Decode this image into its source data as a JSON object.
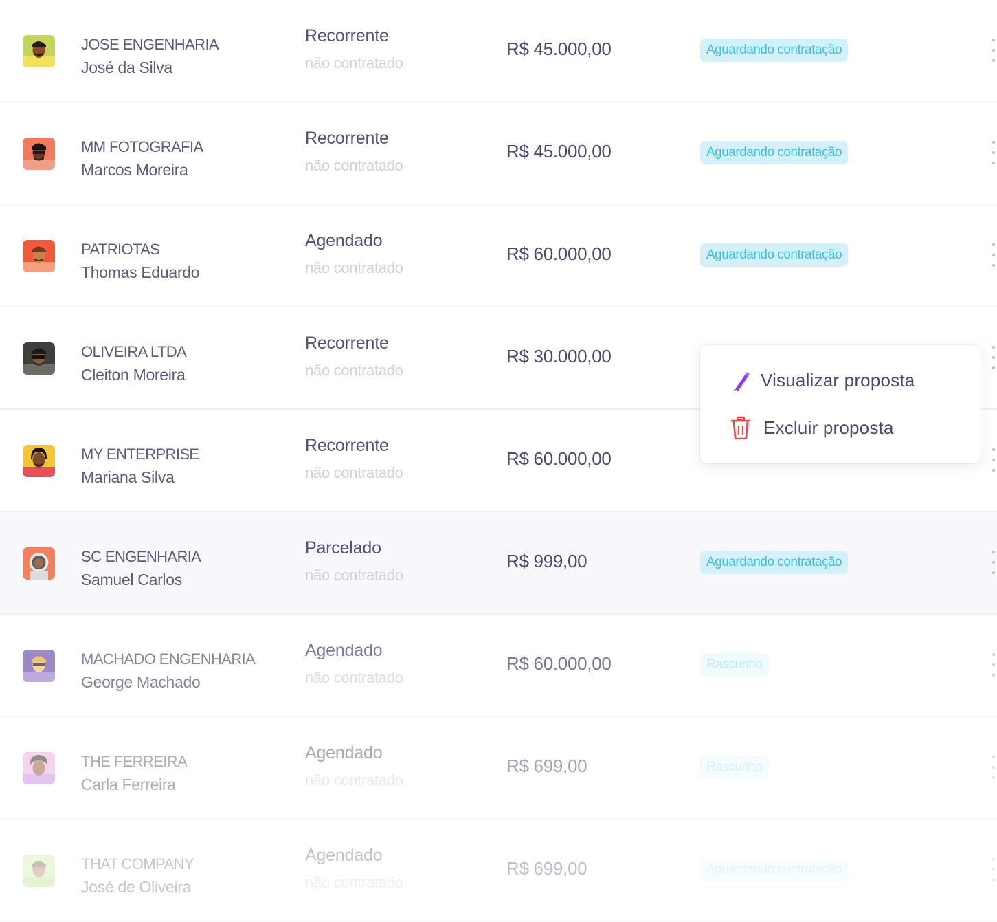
{
  "colors": {
    "text_primary": "#5e5a7d",
    "badge_background": "#d4f1fb",
    "badge_text": "#3cc0e0",
    "edit_icon": "#8b3cf5",
    "delete_icon": "#ee4343"
  },
  "rows": [
    {
      "company": "JOSE ENGENHARIA",
      "person": "José da Silva",
      "type": "Recorrente",
      "contract_status": "não contratado",
      "value": "R$ 45.000,00",
      "status": "Aguardando contratação",
      "avatar_icon": "avatar-man-icon"
    },
    {
      "company": "MM FOTOGRAFIA",
      "person": "Marcos Moreira",
      "type": "Recorrente",
      "contract_status": "não contratado",
      "value": "R$ 45.000,00",
      "status": "Aguardando contratação",
      "avatar_icon": "avatar-man-icon"
    },
    {
      "company": "PATRIOTAS",
      "person": "Thomas Eduardo",
      "type": "Agendado",
      "contract_status": "não contratado",
      "value": "R$ 60.000,00",
      "status": "Aguardando contratação",
      "avatar_icon": "avatar-man-icon"
    },
    {
      "company": "OLIVEIRA LTDA",
      "person": "Cleiton Moreira",
      "type": "Recorrente",
      "contract_status": "não contratado",
      "value": "R$ 30.000,00",
      "status": "",
      "avatar_icon": "avatar-man-sunglasses-icon"
    },
    {
      "company": "MY ENTERPRISE",
      "person": "Mariana Silva",
      "type": "Recorrente",
      "contract_status": "não contratado",
      "value": "R$ 60.000,00",
      "status": "",
      "avatar_icon": "avatar-woman-icon"
    },
    {
      "company": "SC ENGENHARIA",
      "person": "Samuel Carlos",
      "type": "Parcelado",
      "contract_status": "não contratado",
      "value": "R$ 999,00",
      "status": "Aguardando contratação",
      "avatar_icon": "avatar-astronaut-icon"
    },
    {
      "company": "MACHADO ENGENHARIA",
      "person": "George Machado",
      "type": "Agendado",
      "contract_status": "não contratado",
      "value": "R$ 60.000,00",
      "status": "Rascunho",
      "avatar_icon": "avatar-man-icon"
    },
    {
      "company": "THE FERREIRA",
      "person": "Carla Ferreira",
      "type": "Agendado",
      "contract_status": "não contratado",
      "value": "R$ 699,00",
      "status": "Rascunho",
      "avatar_icon": "avatar-woman-icon"
    },
    {
      "company": "THAT COMPANY",
      "person": "José de Oliveira",
      "type": "Agendado",
      "contract_status": "não contratado",
      "value": "R$ 699,00",
      "status": "Aguardando contratação",
      "avatar_icon": "avatar-man-icon"
    }
  ],
  "context_menu": {
    "view_label": "Visualizar proposta",
    "view_icon": "pencil-icon",
    "delete_label": "Excluir proposta",
    "delete_icon": "trash-icon"
  }
}
